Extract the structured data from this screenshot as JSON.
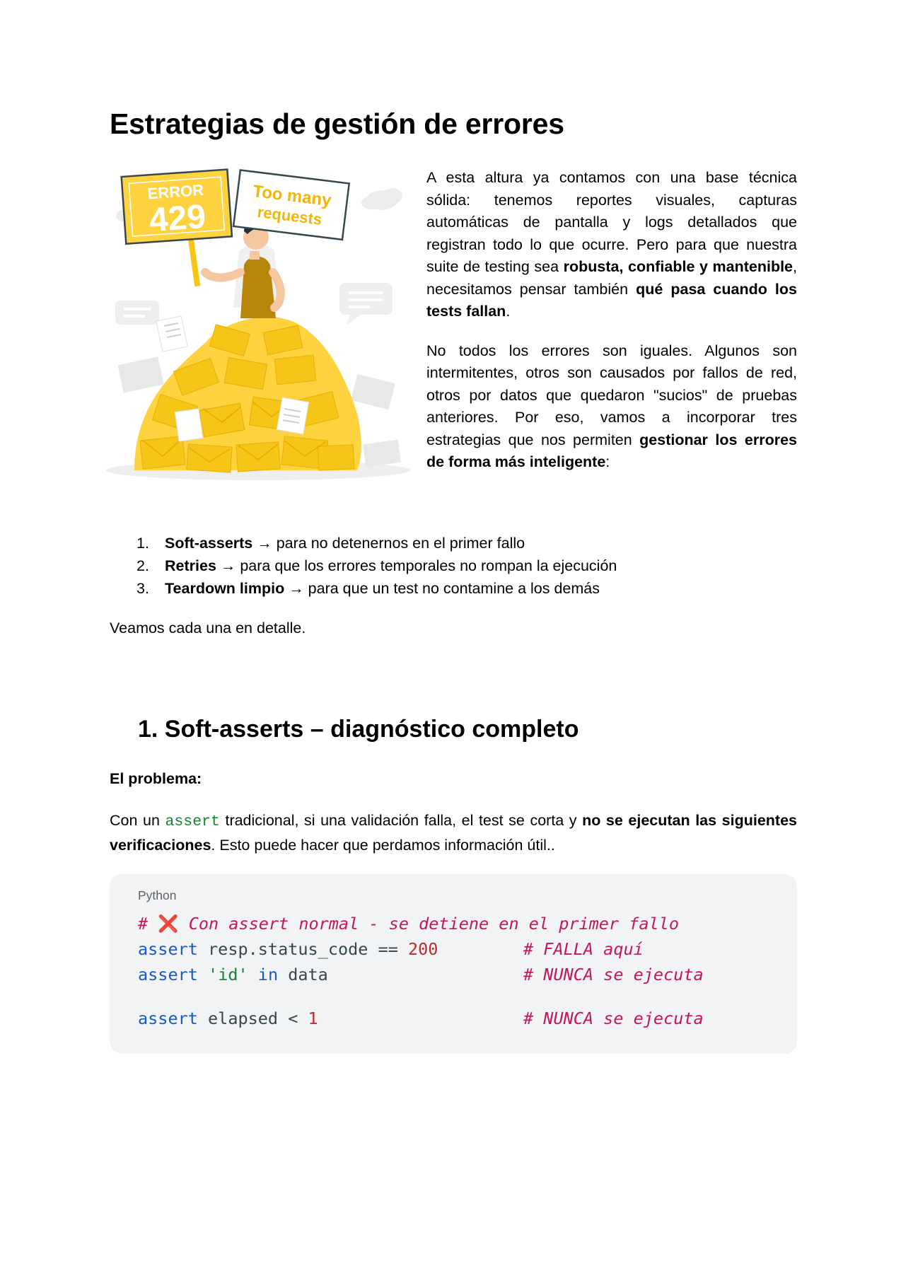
{
  "page_title": "Estrategias de gestión de errores",
  "illustration": {
    "sign_error_label": "ERROR",
    "sign_error_code": "429",
    "sign_line1": "Too many",
    "sign_line2": "requests",
    "colors": {
      "accent": "#ffd23f",
      "accent_dark": "#f2b705",
      "body": "#b8860b"
    }
  },
  "intro": {
    "p1_a": "A esta altura ya contamos con una base técnica sólida: tenemos reportes visuales, capturas automáticas de pantalla y logs detallados que registran todo lo que ocurre. Pero para que nuestra suite de testing sea ",
    "p1_b1": "robusta, confiable y mantenible",
    "p1_c": ", necesitamos pensar también ",
    "p1_b2": "qué pasa cuando los tests fallan",
    "p1_d": ".",
    "p2_a": "No todos los errores son iguales. Algunos son intermitentes, otros son causados por fallos de red, otros por datos que quedaron \"sucios\" de pruebas anteriores. Por eso, vamos a incorporar tres estrategias que nos permiten ",
    "p2_b": "gestionar los errores de forma más inteligente",
    "p2_c": ":"
  },
  "strategies": [
    {
      "num": "1.",
      "title": "Soft-asserts",
      "desc": " → para no detenernos en el primer fallo"
    },
    {
      "num": "2.",
      "title": "Retries",
      "desc": " → para que los errores temporales no rompan la ejecución"
    },
    {
      "num": "3.",
      "title": "Teardown limpio",
      "desc": " → para que un test no contamine a los demás"
    }
  ],
  "see_each": "Veamos cada una en detalle.",
  "section1": {
    "heading": "1. Soft-asserts – diagnóstico completo",
    "problem_label": "El problema:",
    "text_a": "Con un ",
    "text_code": "assert",
    "text_b": " tradicional, si una validación falla, el test se corta y ",
    "text_bold": "no se ejecutan las siguientes verificaciones",
    "text_c": ". Esto puede hacer que perdamos información útil..",
    "code": {
      "language": "Python",
      "comment_hash": "# ",
      "comment_mark": "❌",
      "comment_text": " Con assert normal - se detiene en el primer fallo",
      "l1_kw": "assert",
      "l1_rest": " resp.status_code == ",
      "l1_num": "200",
      "l1_comment": "# FALLA aquí",
      "l2_kw": "assert",
      "l2_str": "'id'",
      "l2_kw2": "in",
      "l2_rest": " data",
      "l2_comment": "# NUNCA se ejecuta",
      "l3_kw": "assert",
      "l3_rest": " elapsed < ",
      "l3_num": "1",
      "l3_comment": "# NUNCA se ejecuta"
    }
  }
}
